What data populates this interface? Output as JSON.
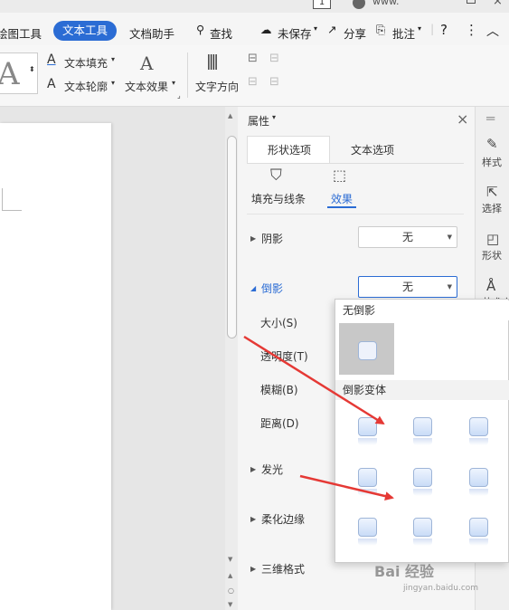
{
  "titlebar": {
    "badge": "1",
    "user": "www."
  },
  "menu": {
    "items": [
      "绘图工具",
      "文本工具",
      "文档助手",
      "查找",
      "未保存",
      "分享",
      "批注",
      "?",
      "⋮",
      "︿"
    ],
    "active": "文本工具"
  },
  "ribbon": {
    "style_preview": "A",
    "text_fill": "文本填充",
    "text_outline": "文本轮廓",
    "text_effect": "文本效果",
    "text_direction": "文字方向"
  },
  "pane": {
    "title": "属性",
    "tabs": [
      "形状选项",
      "文本选项"
    ],
    "subtabs": [
      "填充与线条",
      "效果"
    ],
    "sections": {
      "shadow": {
        "label": "阴影",
        "value": "无"
      },
      "reflection": {
        "label": "倒影",
        "value": "无"
      },
      "size": "大小(S)",
      "transparency": "透明度(T)",
      "blur": "模糊(B)",
      "distance": "距离(D)",
      "glow": "发光",
      "soft_edges": "柔化边缘",
      "three_d": "三维格式"
    }
  },
  "sidebar": {
    "items": [
      "样式",
      "选择",
      "形状",
      "艺术字"
    ]
  },
  "popup": {
    "no_reflection": "无倒影",
    "variants": "倒影变体"
  },
  "watermark": {
    "text": "Bai 经验",
    "sub": "jingyan.baidu.com"
  },
  "colors": {
    "accent": "#2b6cd4",
    "annotation": "#e53935"
  }
}
